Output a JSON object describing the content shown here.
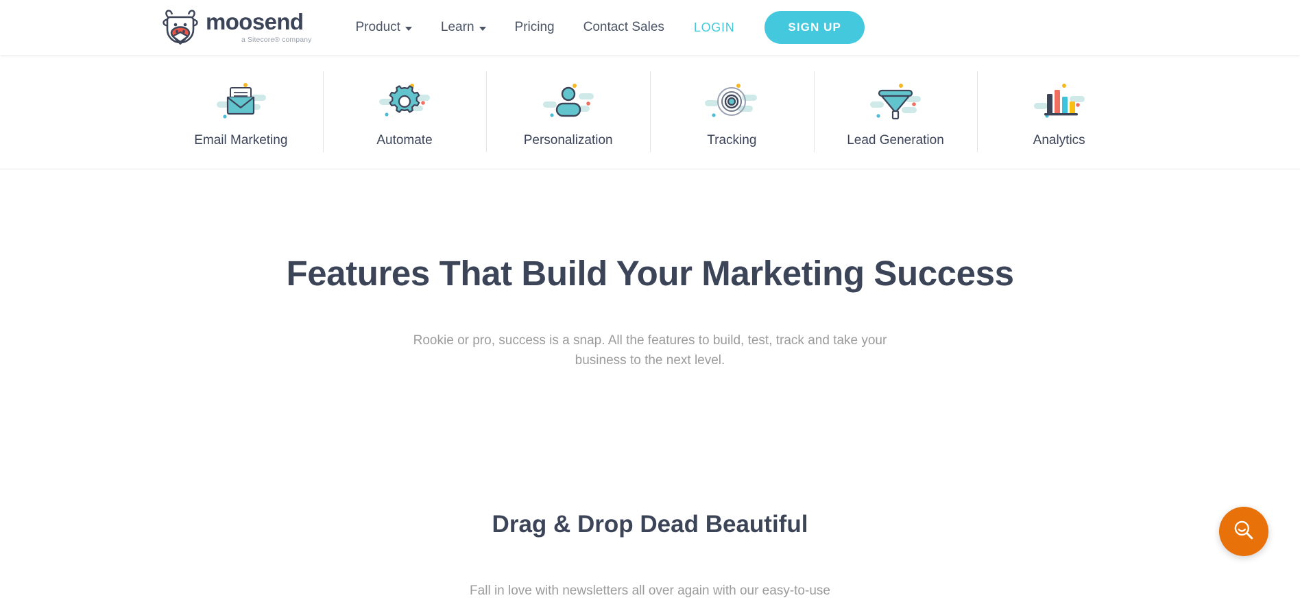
{
  "header": {
    "logo": {
      "icon": "cow-mascot-icon",
      "word": "moosend",
      "tagline": "a Sitecore® company"
    },
    "nav": [
      {
        "label": "Product",
        "has_dropdown": true
      },
      {
        "label": "Learn",
        "has_dropdown": true
      },
      {
        "label": "Pricing",
        "has_dropdown": false
      },
      {
        "label": "Contact Sales",
        "has_dropdown": false
      }
    ],
    "login_label": "LOGIN",
    "signup_label": "SIGN UP"
  },
  "feature_bar": {
    "items": [
      {
        "label": "Email Marketing",
        "icon": "envelope-icon"
      },
      {
        "label": "Automate",
        "icon": "gear-icon"
      },
      {
        "label": "Personalization",
        "icon": "person-icon"
      },
      {
        "label": "Tracking",
        "icon": "target-icon"
      },
      {
        "label": "Lead Generation",
        "icon": "funnel-icon"
      },
      {
        "label": "Analytics",
        "icon": "bar-chart-icon"
      }
    ]
  },
  "main": {
    "hero_title": "Features That Build Your Marketing Success",
    "hero_subtitle": "Rookie or pro, success is a snap. All the features to build, test, track and take your business to the next level.",
    "section_title": "Drag & Drop Dead Beautiful",
    "section_body": "Fall in love with newsletters all over again with our easy-to-use"
  },
  "floating_button": {
    "icon": "search-smile-icon"
  },
  "colors": {
    "accent_cyan": "#43c8dd",
    "navy": "#3c4458",
    "muted_gray": "#9b9b9b",
    "teal": "#62c4cd",
    "pale_teal": "#cfe9e9",
    "orange_fab": "#e8710a",
    "yellow_dot": "#f5b722",
    "coral_dot": "#ef6f61"
  }
}
